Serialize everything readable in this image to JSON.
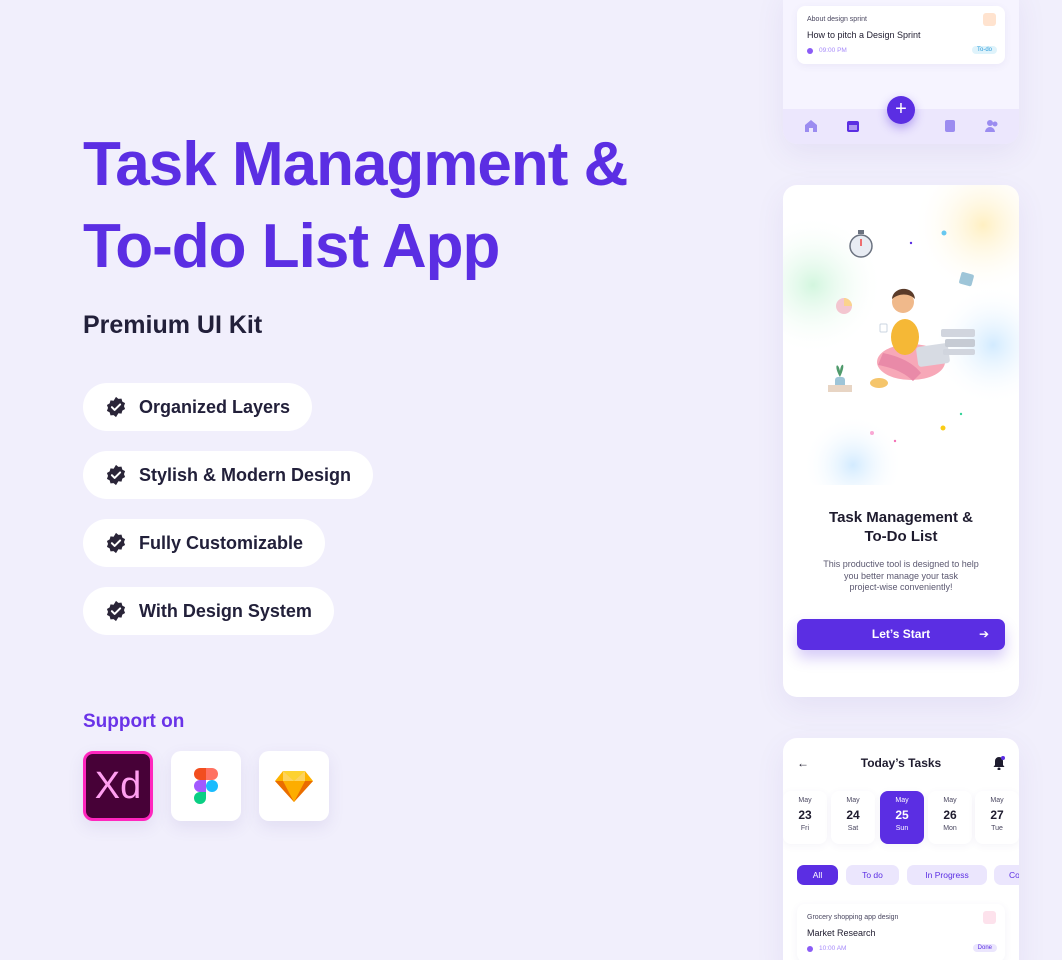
{
  "hero": {
    "title_line1": "Task Managment &",
    "title_line2": "To-do List App",
    "subtitle": "Premium UI Kit"
  },
  "features": [
    {
      "label": "Organized Layers"
    },
    {
      "label": "Stylish & Modern Design"
    },
    {
      "label": "Fully Customizable"
    },
    {
      "label": "With Design System"
    }
  ],
  "support": {
    "title": "Support on",
    "tools": [
      "xd-icon",
      "figma-icon",
      "sketch-icon"
    ],
    "xd_label": "Xd"
  },
  "top_card": {
    "task": {
      "category": "About design sprint",
      "name": "How to pitch a Design Sprint",
      "time": "09:00 PM",
      "status": "To-do"
    },
    "tabbar_icons": [
      "home-icon",
      "calendar-icon",
      "add-icon",
      "document-icon",
      "team-icon"
    ],
    "fab_label": "+"
  },
  "onboarding": {
    "title_line1": "Task Management &",
    "title_line2": "To-Do List",
    "desc_line1": "This productive tool is designed to help",
    "desc_line2": "you better manage your task",
    "desc_line3": "project-wise conveniently!",
    "button": "Let’s Start"
  },
  "today": {
    "title": "Today’s Tasks",
    "days": [
      {
        "month": "May",
        "day": "23",
        "weekday": "Fri",
        "active": false
      },
      {
        "month": "May",
        "day": "24",
        "weekday": "Sat",
        "active": false
      },
      {
        "month": "May",
        "day": "25",
        "weekday": "Sun",
        "active": true
      },
      {
        "month": "May",
        "day": "26",
        "weekday": "Mon",
        "active": false
      },
      {
        "month": "May",
        "day": "27",
        "weekday": "Tue",
        "active": false
      }
    ],
    "filters": [
      "All",
      "To do",
      "In Progress",
      "Co"
    ],
    "active_filter": "All",
    "task": {
      "category": "Grocery shopping app design",
      "name": "Market Research",
      "time": "10:00 AM",
      "status": "Done"
    }
  },
  "colors": {
    "background": "#f1effc",
    "primary": "#5b2ee3",
    "text": "#1e1b2e"
  }
}
